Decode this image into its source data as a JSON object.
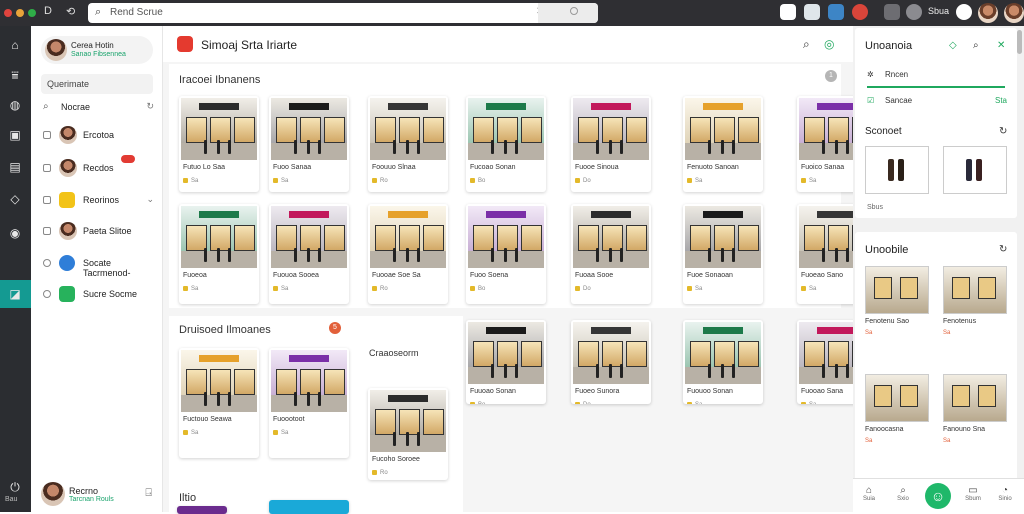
{
  "browser": {
    "url_text": "Rend Scrue",
    "ext_label": "Sbua",
    "traffic_colors": [
      "#e0443e",
      "#e8a33a",
      "#2fae48"
    ]
  },
  "rail": {
    "bottom_label": "Bau"
  },
  "sidebar": {
    "profile": {
      "name": "Cerea Hotin",
      "subtitle": "Sanao Fibsennea"
    },
    "search_placeholder": "Querimate",
    "items": [
      {
        "label": "Nocrae",
        "kind": "search"
      },
      {
        "label": "Ercotoa",
        "kind": "avatar"
      },
      {
        "label": "Recdos",
        "kind": "avatar",
        "badge": true
      },
      {
        "label": "Reorinos",
        "kind": "yellow",
        "tail": "⌄"
      },
      {
        "label": "Paeta Slitoe",
        "kind": "avatar"
      },
      {
        "label": "Socate Tacrmenod-",
        "kind": "blue"
      },
      {
        "label": "Sucre Socme",
        "kind": "green"
      }
    ],
    "footer": {
      "name": "Recrno",
      "subtitle": "Tarcnan Rouls"
    }
  },
  "main": {
    "title": "Simoaj Srta Iriarte",
    "sections": [
      {
        "title": "Iracoei Ibnanens",
        "badge": "1"
      },
      {
        "title": "Druisoed Ilmoanes",
        "badge": "5"
      },
      {
        "title": "Iltio"
      }
    ],
    "cards": [
      {
        "caption": "Futuo Lo Saa",
        "meta": "Sa"
      },
      {
        "caption": "Fuoo Sanaa",
        "meta": "Sa"
      },
      {
        "caption": "Foouuo Slnaa",
        "meta": "Ro"
      },
      {
        "caption": "Fucoao Sonan",
        "meta": "Bo"
      },
      {
        "caption": "Fuooe Sinoua",
        "meta": "Do"
      },
      {
        "caption": "Fenuoto Sanoan",
        "meta": "Sa"
      },
      {
        "caption": "Fuoico Sanaa",
        "meta": "Sa"
      },
      {
        "caption": "Fuoeoa",
        "meta": "Sa"
      },
      {
        "caption": "Fuouoa Sooea",
        "meta": "Sa"
      },
      {
        "caption": "Fuooae Soe Sa",
        "meta": "Ro"
      },
      {
        "caption": "Fuoo Soena",
        "meta": "Bo"
      },
      {
        "caption": "Fuoaa Sooe",
        "meta": "Do"
      },
      {
        "caption": "Fuoe Sonaoan",
        "meta": "Sa"
      },
      {
        "caption": "Fuoeao Sano",
        "meta": "Sa"
      },
      {
        "caption": "Fuctouo Seawa",
        "meta": "Sa"
      },
      {
        "caption": "Fuoootoot",
        "meta": "Sa"
      },
      {
        "caption": "Fucoho Soroee",
        "meta": "Ro"
      },
      {
        "caption": "Fuuoao Sonan",
        "meta": "Bo"
      },
      {
        "caption": "Fuoeo Sunora",
        "meta": "Do"
      },
      {
        "caption": "Fuouoo Sonan",
        "meta": "Sa"
      },
      {
        "caption": "Fuooao Sana",
        "meta": "Sa"
      }
    ],
    "floating_label": "Craaoseorm"
  },
  "right": {
    "top": {
      "title": "Unoanoia",
      "row1": "Rncen",
      "row2": "Sancae",
      "row2_tail": "Sta",
      "section": "Sconoet",
      "footer": "Sbus"
    },
    "bottom": {
      "title": "Unoobile",
      "items": [
        {
          "caption": "Fenotenu Sao",
          "meta": "Sa"
        },
        {
          "caption": "Fenotenus",
          "meta": "Sa"
        },
        {
          "caption": "Fanoocasna",
          "meta": "Sa"
        },
        {
          "caption": "Fanouno Sna",
          "meta": "Sa"
        }
      ]
    },
    "nav": [
      {
        "label": "Suia"
      },
      {
        "label": "Sxio"
      },
      {
        "label": "Sbum"
      },
      {
        "label": "Sinio"
      }
    ]
  }
}
